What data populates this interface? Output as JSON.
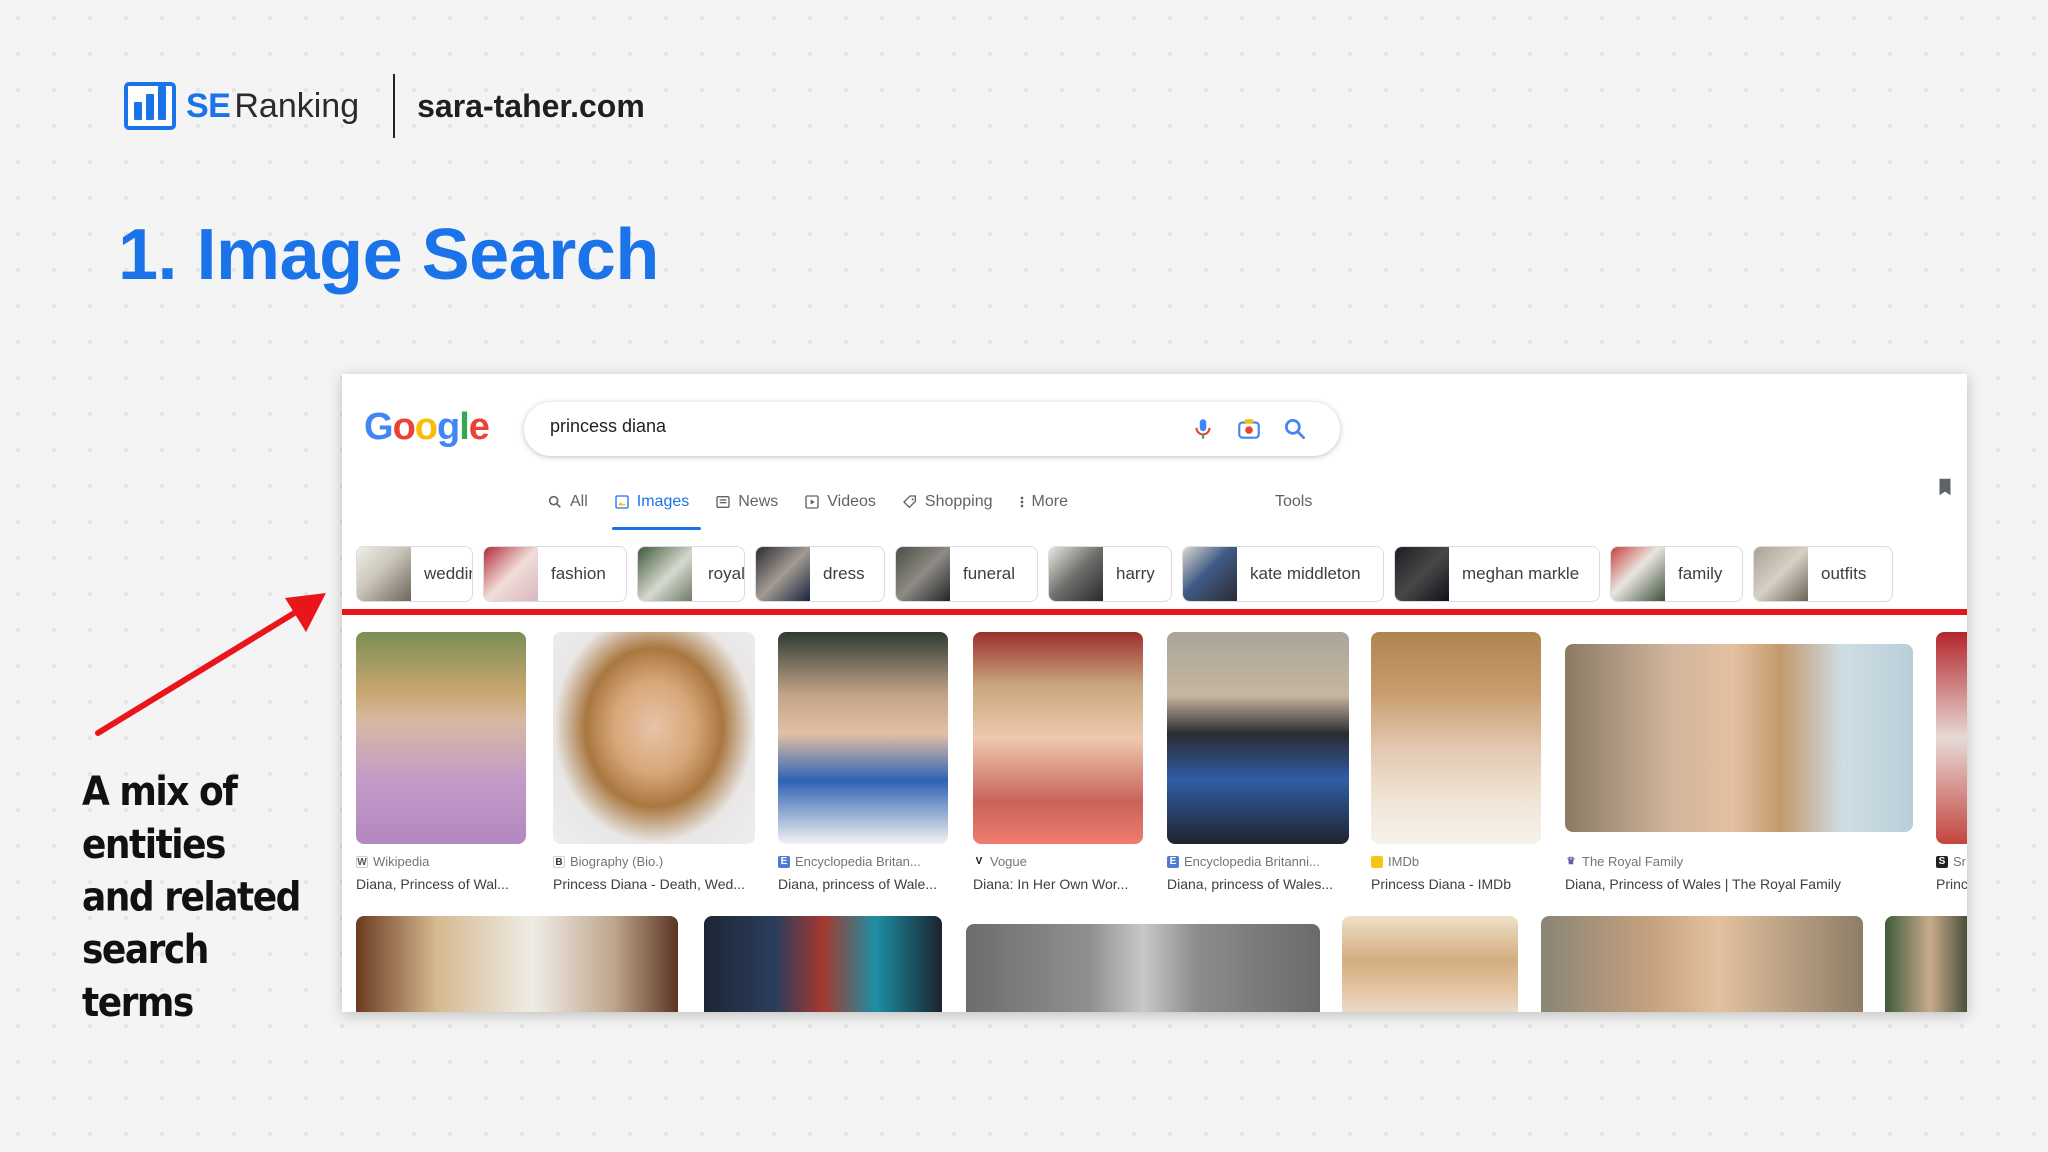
{
  "header": {
    "brand_se": "SE",
    "brand_ranking": "Ranking",
    "site": "sara-taher.com"
  },
  "slide_title": "1. Image Search",
  "annotation": {
    "lines": [
      "A mix of",
      "entities",
      "and related",
      "search",
      "terms"
    ],
    "arrow_color": "#e8161b"
  },
  "google": {
    "logo": [
      "G",
      "o",
      "o",
      "g",
      "l",
      "e"
    ],
    "search": {
      "query": "princess diana"
    },
    "tabs": [
      {
        "label": "All",
        "icon": "search-icon"
      },
      {
        "label": "Images",
        "icon": "image-icon",
        "active": true
      },
      {
        "label": "News",
        "icon": "news-icon"
      },
      {
        "label": "Videos",
        "icon": "play-icon"
      },
      {
        "label": "Shopping",
        "icon": "tag-icon"
      },
      {
        "label": "More",
        "icon": "more-vert-icon"
      }
    ],
    "tools": "Tools",
    "chips": [
      "wedding",
      "fashion",
      "royal",
      "dress",
      "funeral",
      "harry",
      "kate middleton",
      "meghan markle",
      "family",
      "outfits"
    ],
    "results_row1": [
      {
        "source": "Wikipedia",
        "title": "Diana, Princess of Wal...",
        "icon_letter": "W"
      },
      {
        "source": "Biography (Bio.)",
        "title": "Princess Diana - Death, Wed...",
        "icon_letter": "B"
      },
      {
        "source": "Encyclopedia Britan...",
        "title": "Diana, princess of Wale...",
        "icon_letter": "E"
      },
      {
        "source": "Vogue",
        "title": "Diana: In Her Own Wor...",
        "icon_letter": "V"
      },
      {
        "source": "Encyclopedia Britanni...",
        "title": "Diana, princess of Wales...",
        "icon_letter": "E"
      },
      {
        "source": "IMDb",
        "title": "Princess Diana - IMDb",
        "icon_letter": ""
      },
      {
        "source": "The Royal Family",
        "title": "Diana, Princess of Wales | The Royal Family",
        "icon_letter": "♛"
      },
      {
        "source": "Sr",
        "title": "Princ",
        "icon_letter": "S"
      }
    ]
  },
  "colors": {
    "accent": "#1a73e8",
    "red": "#e8161b"
  }
}
